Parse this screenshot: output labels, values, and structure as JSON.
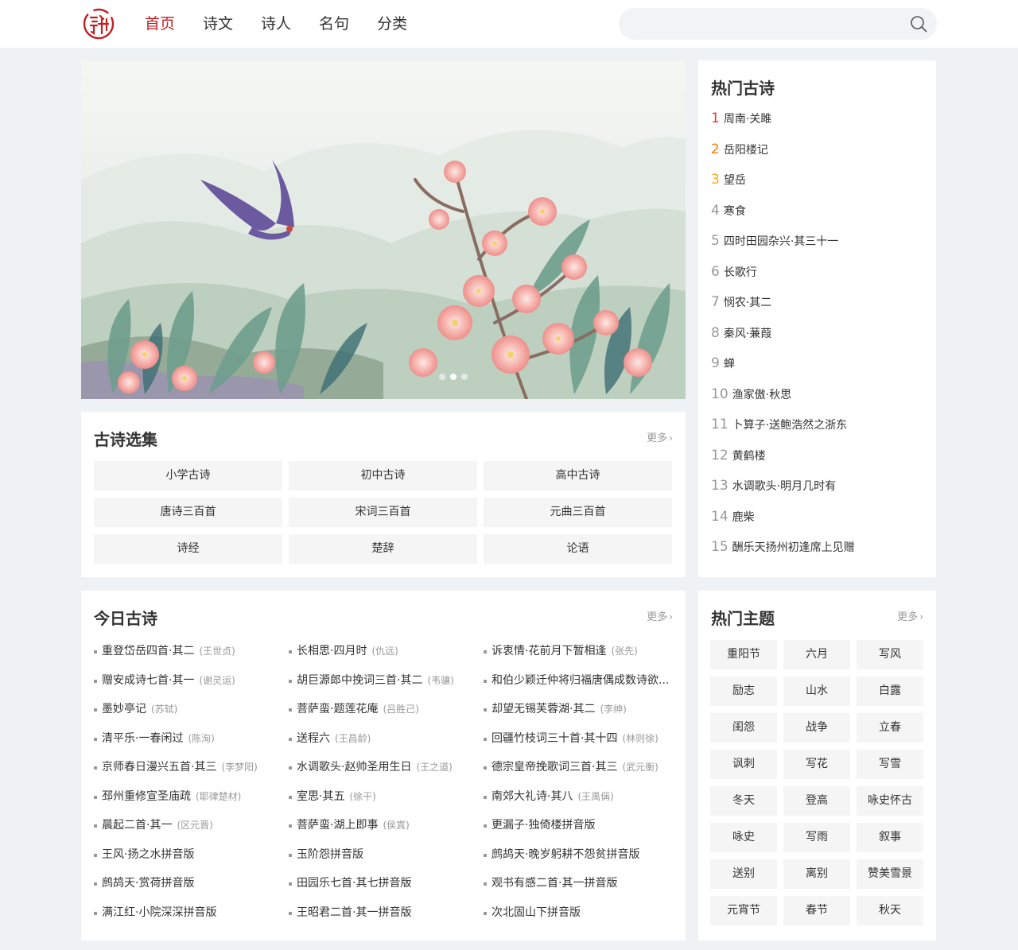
{
  "nav": {
    "items": [
      {
        "label": "首页",
        "active": true
      },
      {
        "label": "诗文"
      },
      {
        "label": "诗人"
      },
      {
        "label": "名句"
      },
      {
        "label": "分类"
      }
    ]
  },
  "search": {
    "placeholder": "",
    "icon": "search-icon"
  },
  "colors": {
    "accent": "#c21f23",
    "page_bg": "#eff2f5",
    "tile_bg": "#f5f5f5",
    "rank1": "#e53935",
    "rank2": "#f57c00",
    "rank3": "#f9a825"
  },
  "collection": {
    "title": "古诗选集",
    "more": "更多",
    "items": [
      "小学古诗",
      "初中古诗",
      "高中古诗",
      "唐诗三百首",
      "宋词三百首",
      "元曲三百首",
      "诗经",
      "楚辞",
      "论语"
    ]
  },
  "today": {
    "title": "今日古诗",
    "more": "更多",
    "columns": [
      [
        {
          "title": "重登岱岳四首·其二",
          "author": "(王世贞)"
        },
        {
          "title": "赠安成诗七首·其一",
          "author": "(谢灵运)"
        },
        {
          "title": "墨妙亭记",
          "author": "(苏轼)"
        },
        {
          "title": "清平乐·一春闲过",
          "author": "(陈洵)"
        },
        {
          "title": "京师春日漫兴五首·其三",
          "author": "(李梦阳)"
        },
        {
          "title": "邳州重修宣圣庙疏",
          "author": "(耶律楚材)"
        },
        {
          "title": "晨起二首·其一",
          "author": "(区元晋)"
        },
        {
          "title": "王风·扬之水拼音版",
          "author": ""
        },
        {
          "title": "鹧鸪天·赏荷拼音版",
          "author": ""
        },
        {
          "title": "满江红·小院深深拼音版",
          "author": ""
        }
      ],
      [
        {
          "title": "长相思·四月时",
          "author": "(仇远)"
        },
        {
          "title": "胡巨源郎中挽词三首·其二",
          "author": "(韦骧)"
        },
        {
          "title": "菩萨蛮·题莲花庵",
          "author": "(吕胜己)"
        },
        {
          "title": "送程六",
          "author": "(王昌龄)"
        },
        {
          "title": "水调歌头·赵帅圣用生日",
          "author": "(王之道)"
        },
        {
          "title": "室思·其五",
          "author": "(徐干)"
        },
        {
          "title": "菩萨蛮·湖上即事",
          "author": "(侯寘)"
        },
        {
          "title": "玉阶怨拼音版",
          "author": ""
        },
        {
          "title": "田园乐七首·其七拼音版",
          "author": ""
        },
        {
          "title": "王昭君二首·其一拼音版",
          "author": ""
        }
      ],
      [
        {
          "title": "诉衷情·花前月下暂相逢",
          "author": "(张先)"
        },
        {
          "title": "和伯少颖迁仲将归福唐偶成数诗欲...",
          "author": ""
        },
        {
          "title": "却望无锡芙蓉湖·其二",
          "author": "(李绅)"
        },
        {
          "title": "回疆竹枝词三十首·其十四",
          "author": "(林则徐)"
        },
        {
          "title": "德宗皇帝挽歌词三首·其三",
          "author": "(武元衡)"
        },
        {
          "title": "南郊大礼诗·其八",
          "author": "(王禹偁)"
        },
        {
          "title": "更漏子·独倚楼拼音版",
          "author": ""
        },
        {
          "title": "鹧鸪天·晚岁躬耕不怨贫拼音版",
          "author": ""
        },
        {
          "title": "观书有感二首·其一拼音版",
          "author": ""
        },
        {
          "title": "次北固山下拼音版",
          "author": ""
        }
      ]
    ]
  },
  "hot": {
    "title": "热门古诗",
    "items": [
      {
        "rank": "1",
        "title": "周南·关雎"
      },
      {
        "rank": "2",
        "title": "岳阳楼记"
      },
      {
        "rank": "3",
        "title": "望岳"
      },
      {
        "rank": "4",
        "title": "寒食"
      },
      {
        "rank": "5",
        "title": "四时田园杂兴·其三十一"
      },
      {
        "rank": "6",
        "title": "长歌行"
      },
      {
        "rank": "7",
        "title": "悯农·其二"
      },
      {
        "rank": "8",
        "title": "秦风·蒹葭"
      },
      {
        "rank": "9",
        "title": "蝉"
      },
      {
        "rank": "10",
        "title": "渔家傲·秋思"
      },
      {
        "rank": "11",
        "title": "卜算子·送鲍浩然之浙东"
      },
      {
        "rank": "12",
        "title": "黄鹤楼"
      },
      {
        "rank": "13",
        "title": "水调歌头·明月几时有"
      },
      {
        "rank": "14",
        "title": "鹿柴"
      },
      {
        "rank": "15",
        "title": "酬乐天扬州初逢席上见赠"
      }
    ]
  },
  "topics": {
    "title": "热门主题",
    "more": "更多",
    "items": [
      "重阳节",
      "六月",
      "写风",
      "励志",
      "山水",
      "白露",
      "闺怨",
      "战争",
      "立春",
      "讽刺",
      "写花",
      "写雪",
      "冬天",
      "登高",
      "咏史怀古",
      "咏史",
      "写雨",
      "叙事",
      "送别",
      "离别",
      "赞美雪景",
      "元宵节",
      "春节",
      "秋天"
    ]
  }
}
